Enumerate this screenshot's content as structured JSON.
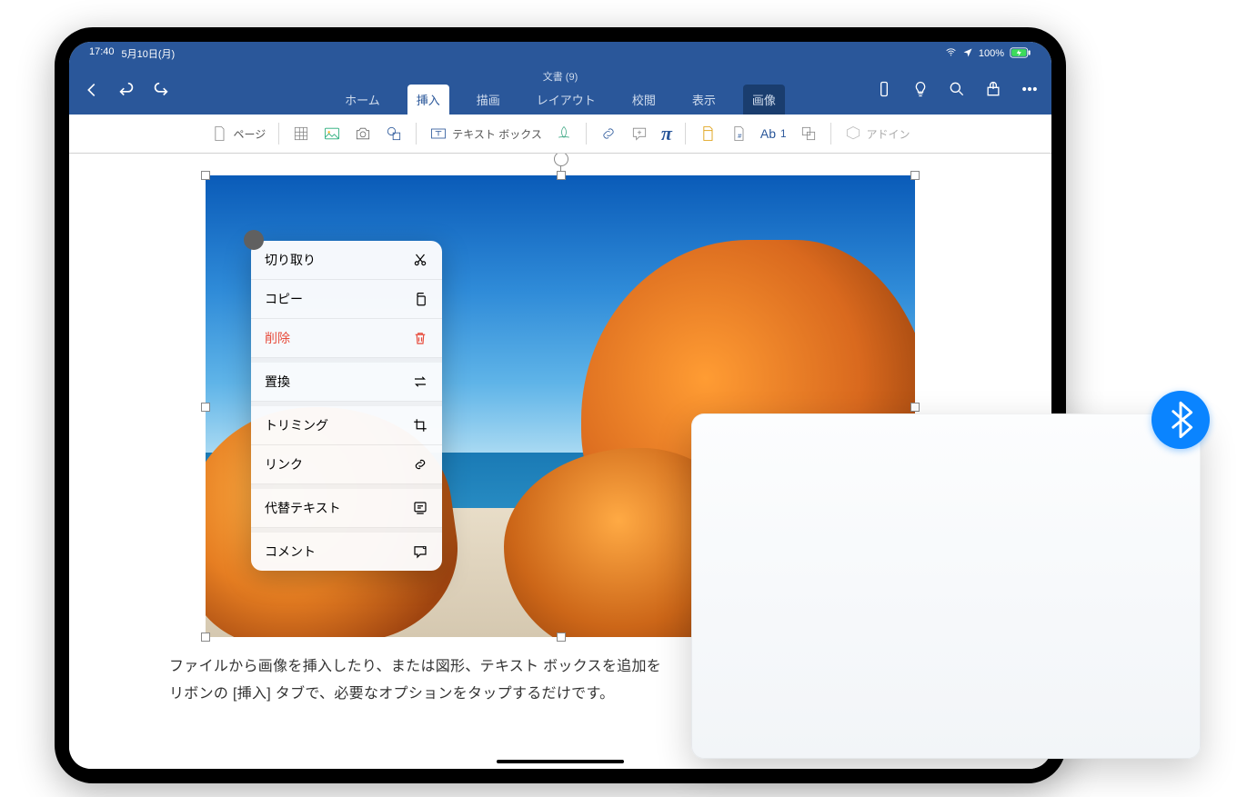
{
  "status": {
    "time": "17:40",
    "date": "5月10日(月)",
    "battery": "100%"
  },
  "doc": {
    "title": "文書 (9)"
  },
  "tabs": {
    "home": "ホーム",
    "insert": "挿入",
    "draw": "描画",
    "layout": "レイアウト",
    "review": "校閲",
    "view": "表示",
    "picture": "画像"
  },
  "ribbon": {
    "page": "ページ",
    "textbox": "テキスト ボックス",
    "addin": "アドイン"
  },
  "menu": {
    "cut": "切り取り",
    "copy": "コピー",
    "delete": "削除",
    "replace": "置換",
    "crop": "トリミング",
    "link": "リンク",
    "alt": "代替テキスト",
    "comment": "コメント"
  },
  "body": {
    "l1": "ファイルから画像を挿入したり、または図形、テキスト ボックスを追加を",
    "l2": "リボンの [挿入] タブで、必要なオプションをタップするだけです。"
  }
}
